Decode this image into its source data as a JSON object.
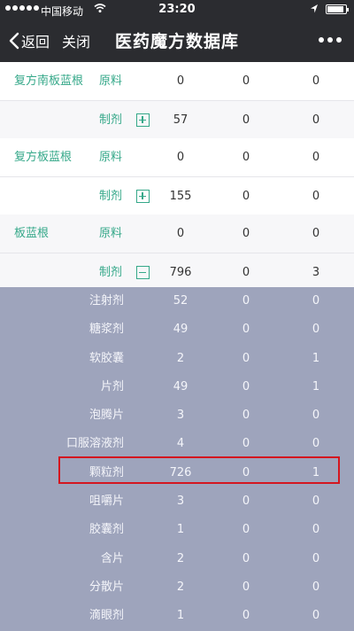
{
  "status_bar": {
    "carrier": "中国移动",
    "time": "23:20"
  },
  "nav": {
    "back_label": "返回",
    "close_label": "关闭",
    "title": "医药魔方数据库"
  },
  "main_rows": [
    {
      "drug": "复方南板蓝根",
      "type": "原料",
      "v1": "0",
      "v2": "0",
      "v3": "0",
      "bg": "w"
    },
    {
      "drug": "",
      "type": "制剂",
      "toggle": "plus",
      "v1": "57",
      "v2": "0",
      "v3": "0",
      "bg": "g"
    },
    {
      "drug": "复方板蓝根",
      "type": "原料",
      "v1": "0",
      "v2": "0",
      "v3": "0",
      "bg": "w"
    },
    {
      "drug": "",
      "type": "制剂",
      "toggle": "plus",
      "v1": "155",
      "v2": "0",
      "v3": "0",
      "bg": "w"
    },
    {
      "drug": "板蓝根",
      "type": "原料",
      "v1": "0",
      "v2": "0",
      "v3": "0",
      "bg": "g"
    },
    {
      "drug": "",
      "type": "制剂",
      "toggle": "minus",
      "v1": "796",
      "v2": "0",
      "v3": "3",
      "bg": "g"
    }
  ],
  "sub_rows": [
    {
      "form": "注射剂",
      "v1": "52",
      "v2": "0",
      "v3": "0"
    },
    {
      "form": "糖浆剂",
      "v1": "49",
      "v2": "0",
      "v3": "0"
    },
    {
      "form": "软胶囊",
      "v1": "2",
      "v2": "0",
      "v3": "1"
    },
    {
      "form": "片剂",
      "v1": "49",
      "v2": "0",
      "v3": "1"
    },
    {
      "form": "泡腾片",
      "v1": "3",
      "v2": "0",
      "v3": "0"
    },
    {
      "form": "口服溶液剂",
      "v1": "4",
      "v2": "0",
      "v3": "0"
    },
    {
      "form": "颗粒剂",
      "v1": "726",
      "v2": "0",
      "v3": "1"
    },
    {
      "form": "咀嚼片",
      "v1": "3",
      "v2": "0",
      "v3": "0"
    },
    {
      "form": "胶囊剂",
      "v1": "1",
      "v2": "0",
      "v3": "0"
    },
    {
      "form": "含片",
      "v1": "2",
      "v2": "0",
      "v3": "0"
    },
    {
      "form": "分散片",
      "v1": "2",
      "v2": "0",
      "v3": "0"
    },
    {
      "form": "滴眼剂",
      "v1": "1",
      "v2": "0",
      "v3": "0"
    }
  ],
  "colors": {
    "accent": "#35a889",
    "header_bg": "#2b2c30",
    "sub_bg": "#9ea4bc",
    "highlight": "#d4161f"
  },
  "icons": [
    "signal-dots-icon",
    "wifi-icon",
    "location-arrow-icon",
    "battery-icon",
    "chevron-left-icon",
    "more-dots-icon",
    "plus-box-icon",
    "minus-box-icon"
  ]
}
